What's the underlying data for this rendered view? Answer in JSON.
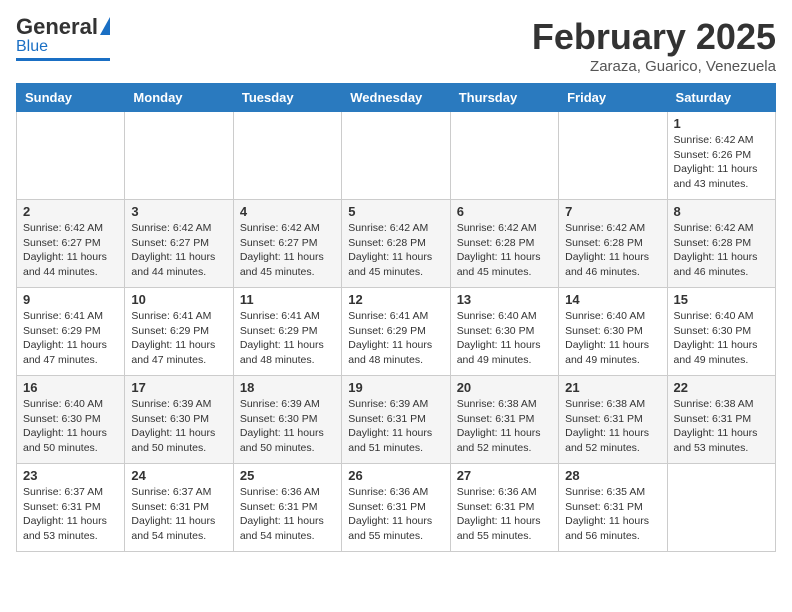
{
  "logo": {
    "general": "General",
    "blue": "Blue"
  },
  "header": {
    "month": "February 2025",
    "location": "Zaraza, Guarico, Venezuela"
  },
  "weekdays": [
    "Sunday",
    "Monday",
    "Tuesday",
    "Wednesday",
    "Thursday",
    "Friday",
    "Saturday"
  ],
  "weeks": [
    [
      null,
      null,
      null,
      null,
      null,
      null,
      {
        "day": 1,
        "sunrise": "6:42 AM",
        "sunset": "6:26 PM",
        "daylight": "11 hours and 43 minutes."
      }
    ],
    [
      {
        "day": 2,
        "sunrise": "6:42 AM",
        "sunset": "6:27 PM",
        "daylight": "11 hours and 44 minutes."
      },
      {
        "day": 3,
        "sunrise": "6:42 AM",
        "sunset": "6:27 PM",
        "daylight": "11 hours and 44 minutes."
      },
      {
        "day": 4,
        "sunrise": "6:42 AM",
        "sunset": "6:27 PM",
        "daylight": "11 hours and 45 minutes."
      },
      {
        "day": 5,
        "sunrise": "6:42 AM",
        "sunset": "6:28 PM",
        "daylight": "11 hours and 45 minutes."
      },
      {
        "day": 6,
        "sunrise": "6:42 AM",
        "sunset": "6:28 PM",
        "daylight": "11 hours and 45 minutes."
      },
      {
        "day": 7,
        "sunrise": "6:42 AM",
        "sunset": "6:28 PM",
        "daylight": "11 hours and 46 minutes."
      },
      {
        "day": 8,
        "sunrise": "6:42 AM",
        "sunset": "6:28 PM",
        "daylight": "11 hours and 46 minutes."
      }
    ],
    [
      {
        "day": 9,
        "sunrise": "6:41 AM",
        "sunset": "6:29 PM",
        "daylight": "11 hours and 47 minutes."
      },
      {
        "day": 10,
        "sunrise": "6:41 AM",
        "sunset": "6:29 PM",
        "daylight": "11 hours and 47 minutes."
      },
      {
        "day": 11,
        "sunrise": "6:41 AM",
        "sunset": "6:29 PM",
        "daylight": "11 hours and 48 minutes."
      },
      {
        "day": 12,
        "sunrise": "6:41 AM",
        "sunset": "6:29 PM",
        "daylight": "11 hours and 48 minutes."
      },
      {
        "day": 13,
        "sunrise": "6:40 AM",
        "sunset": "6:30 PM",
        "daylight": "11 hours and 49 minutes."
      },
      {
        "day": 14,
        "sunrise": "6:40 AM",
        "sunset": "6:30 PM",
        "daylight": "11 hours and 49 minutes."
      },
      {
        "day": 15,
        "sunrise": "6:40 AM",
        "sunset": "6:30 PM",
        "daylight": "11 hours and 49 minutes."
      }
    ],
    [
      {
        "day": 16,
        "sunrise": "6:40 AM",
        "sunset": "6:30 PM",
        "daylight": "11 hours and 50 minutes."
      },
      {
        "day": 17,
        "sunrise": "6:39 AM",
        "sunset": "6:30 PM",
        "daylight": "11 hours and 50 minutes."
      },
      {
        "day": 18,
        "sunrise": "6:39 AM",
        "sunset": "6:30 PM",
        "daylight": "11 hours and 50 minutes."
      },
      {
        "day": 19,
        "sunrise": "6:39 AM",
        "sunset": "6:31 PM",
        "daylight": "11 hours and 51 minutes."
      },
      {
        "day": 20,
        "sunrise": "6:38 AM",
        "sunset": "6:31 PM",
        "daylight": "11 hours and 52 minutes."
      },
      {
        "day": 21,
        "sunrise": "6:38 AM",
        "sunset": "6:31 PM",
        "daylight": "11 hours and 52 minutes."
      },
      {
        "day": 22,
        "sunrise": "6:38 AM",
        "sunset": "6:31 PM",
        "daylight": "11 hours and 53 minutes."
      }
    ],
    [
      {
        "day": 23,
        "sunrise": "6:37 AM",
        "sunset": "6:31 PM",
        "daylight": "11 hours and 53 minutes."
      },
      {
        "day": 24,
        "sunrise": "6:37 AM",
        "sunset": "6:31 PM",
        "daylight": "11 hours and 54 minutes."
      },
      {
        "day": 25,
        "sunrise": "6:36 AM",
        "sunset": "6:31 PM",
        "daylight": "11 hours and 54 minutes."
      },
      {
        "day": 26,
        "sunrise": "6:36 AM",
        "sunset": "6:31 PM",
        "daylight": "11 hours and 55 minutes."
      },
      {
        "day": 27,
        "sunrise": "6:36 AM",
        "sunset": "6:31 PM",
        "daylight": "11 hours and 55 minutes."
      },
      {
        "day": 28,
        "sunrise": "6:35 AM",
        "sunset": "6:31 PM",
        "daylight": "11 hours and 56 minutes."
      },
      null
    ]
  ]
}
